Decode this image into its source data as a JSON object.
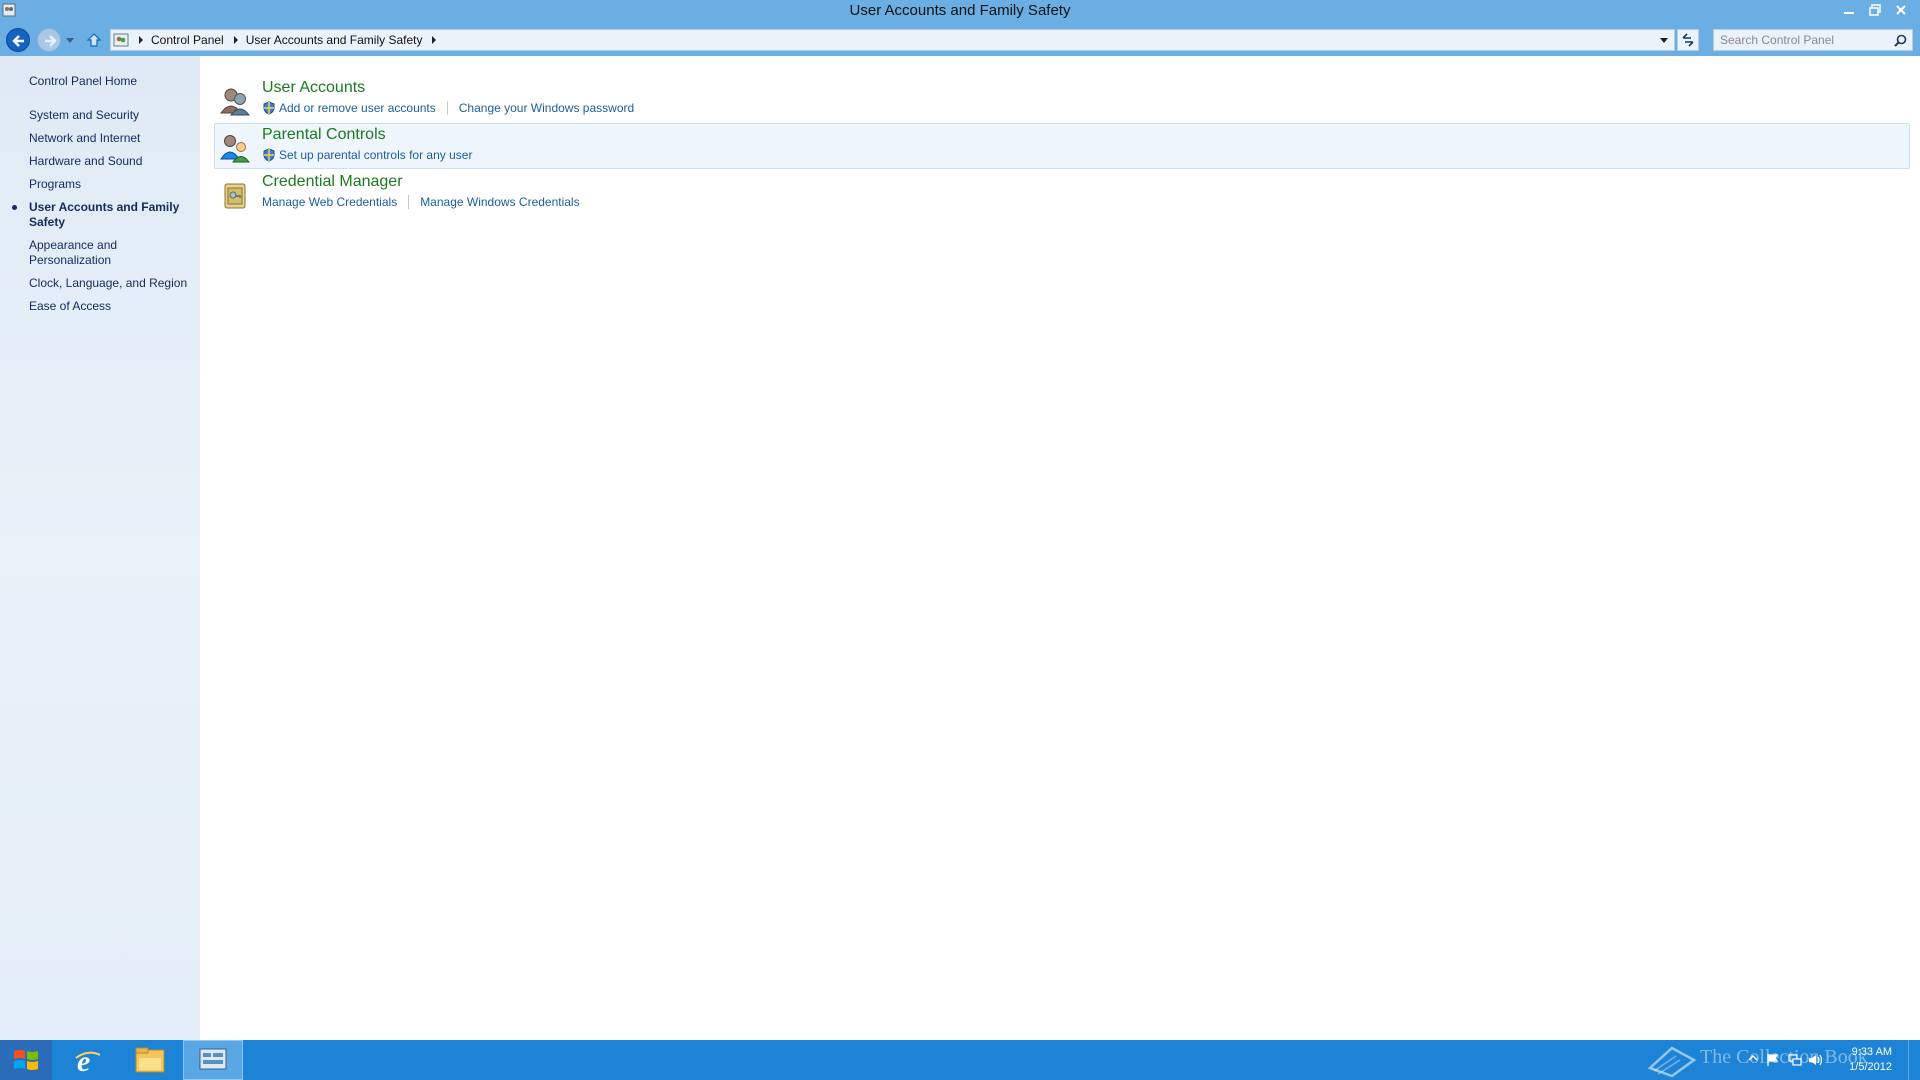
{
  "window": {
    "title": "User Accounts and Family Safety",
    "icons": {
      "app": "control-panel-icon",
      "minimize": "minimize-icon",
      "restore": "restore-icon",
      "close": "close-icon"
    }
  },
  "navigation": {
    "breadcrumbs": [
      "Control Panel",
      "User Accounts and Family Safety"
    ],
    "search_placeholder": "Search Control Panel"
  },
  "sidebar": {
    "home": "Control Panel Home",
    "items": [
      {
        "label": "System and Security",
        "current": false
      },
      {
        "label": "Network and Internet",
        "current": false
      },
      {
        "label": "Hardware and Sound",
        "current": false
      },
      {
        "label": "Programs",
        "current": false
      },
      {
        "label": "User Accounts and Family Safety",
        "current": true
      },
      {
        "label": "Appearance and Personalization",
        "current": false
      },
      {
        "label": "Clock, Language, and Region",
        "current": false
      },
      {
        "label": "Ease of Access",
        "current": false
      }
    ]
  },
  "categories": [
    {
      "title": "User Accounts",
      "icon": "user-accounts-icon",
      "links": [
        {
          "label": "Add or remove user accounts",
          "shield": true
        },
        {
          "label": "Change your Windows password",
          "shield": false
        }
      ]
    },
    {
      "title": "Parental Controls",
      "icon": "parental-controls-icon",
      "links": [
        {
          "label": "Set up parental controls for any user",
          "shield": true
        }
      ]
    },
    {
      "title": "Credential Manager",
      "icon": "credential-manager-icon",
      "links": [
        {
          "label": "Manage Web Credentials",
          "shield": false
        },
        {
          "label": "Manage Windows Credentials",
          "shield": false
        }
      ]
    }
  ],
  "taskbar": {
    "items": [
      "start-icon",
      "internet-explorer-icon",
      "file-explorer-icon",
      "control-panel-icon"
    ],
    "watermark": "The Collection Book",
    "clock": {
      "time": "9:33 AM",
      "date": "1/5/2012"
    }
  },
  "colors": {
    "chrome": "#6aaee3",
    "link": "#1c5d9e",
    "category_title": "#1d7a20",
    "taskbar": "#1c83d6"
  }
}
